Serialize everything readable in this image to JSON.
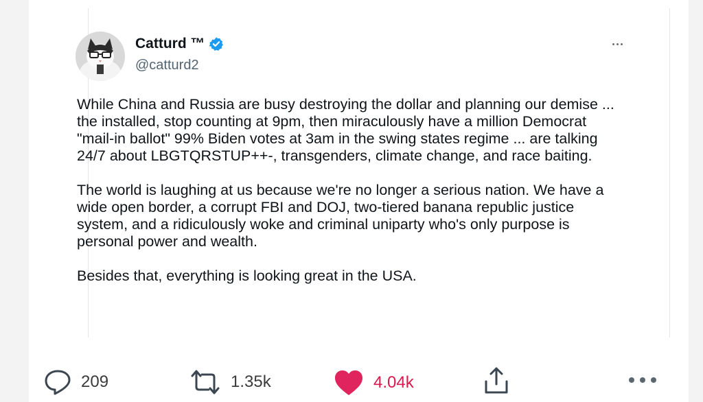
{
  "tweet": {
    "author": {
      "display_name": "Catturd ™",
      "handle": "@catturd2",
      "verified": true
    },
    "paragraphs": [
      "While China and Russia are busy destroying the dollar and planning our demise ... the installed, stop counting at 9pm, then miraculously have a million Democrat \"mail-in ballot\" 99% Biden votes at 3am in the swing states regime ... are talking 24/7 about LBGTQRSTUP++-, transgenders, climate change, and race baiting.",
      "The world is laughing at us because we're no longer a serious nation. We have a wide open border, a corrupt FBI and DOJ, two-tiered banana republic justice system, and a ridiculously woke and criminal uniparty who's only purpose is personal power and wealth.",
      "Besides that, everything is looking great in the USA."
    ]
  },
  "actions": {
    "replies": "209",
    "retweets": "1.35k",
    "likes": "4.04k"
  },
  "colors": {
    "text": "#0f1419",
    "secondary_text": "#536471",
    "verified_blue": "#1d9bf0",
    "like_red": "#e0245e"
  },
  "icons": {
    "reply": "reply-icon",
    "retweet": "retweet-icon",
    "like": "heart-icon",
    "share": "share-icon",
    "more": "more-icon"
  }
}
